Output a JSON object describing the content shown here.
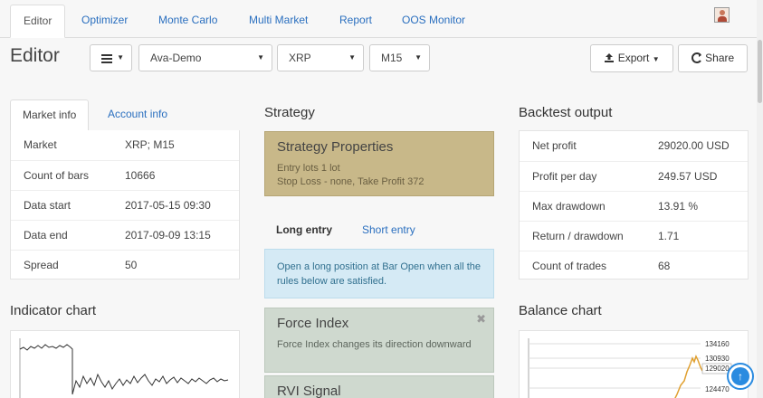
{
  "nav": {
    "tabs": [
      {
        "label": "Editor"
      },
      {
        "label": "Optimizer"
      },
      {
        "label": "Monte Carlo"
      },
      {
        "label": "Multi Market"
      },
      {
        "label": "Report"
      },
      {
        "label": "OOS Monitor"
      }
    ],
    "active_tab": "Editor"
  },
  "header": {
    "title": "Editor",
    "menu_icon": "hamburger-icon",
    "account_select": "Ava-Demo",
    "symbol_select": "XRP",
    "period_select": "M15",
    "export_label": "Export",
    "share_label": "Share"
  },
  "info_tabs": {
    "market_tab": "Market info",
    "account_tab": "Account info"
  },
  "market_info": [
    {
      "key": "Market",
      "value": "XRP; M15"
    },
    {
      "key": "Count of bars",
      "value": "10666"
    },
    {
      "key": "Data start",
      "value": "2017-05-15 09:30"
    },
    {
      "key": "Data end",
      "value": "2017-09-09 13:15"
    },
    {
      "key": "Spread",
      "value": "50"
    }
  ],
  "indicator_chart": {
    "title": "Indicator chart"
  },
  "strategy": {
    "title": "Strategy",
    "props_title": "Strategy Properties",
    "props_line1": "Entry lots 1 lot",
    "props_line2": "Stop Loss - none, Take Profit 372",
    "long_entry_tab": "Long entry",
    "short_entry_tab": "Short entry",
    "info_text": "Open a long position at Bar Open when all the rules below are satisfied.",
    "rules": [
      {
        "title": "Force Index",
        "description": "Force Index changes its direction downward"
      },
      {
        "title": "RVI Signal",
        "description": ""
      }
    ]
  },
  "backtest": {
    "title": "Backtest output",
    "rows": [
      {
        "key": "Net profit",
        "value": "29020.00 USD"
      },
      {
        "key": "Profit per day",
        "value": "249.57 USD"
      },
      {
        "key": "Max drawdown",
        "value": "13.91 %"
      },
      {
        "key": "Return / drawdown",
        "value": "1.71"
      },
      {
        "key": "Count of trades",
        "value": "68"
      }
    ]
  },
  "balance_chart": {
    "title": "Balance chart",
    "labels": [
      "134160",
      "130930",
      "129020",
      "124470"
    ]
  },
  "colors": {
    "link": "#2a6fbf",
    "strategy_props_bg": "#c8b889",
    "info_bg": "#d5eaf5",
    "rule_bg": "#cfd9cf",
    "balance_line": "#e0a030"
  }
}
